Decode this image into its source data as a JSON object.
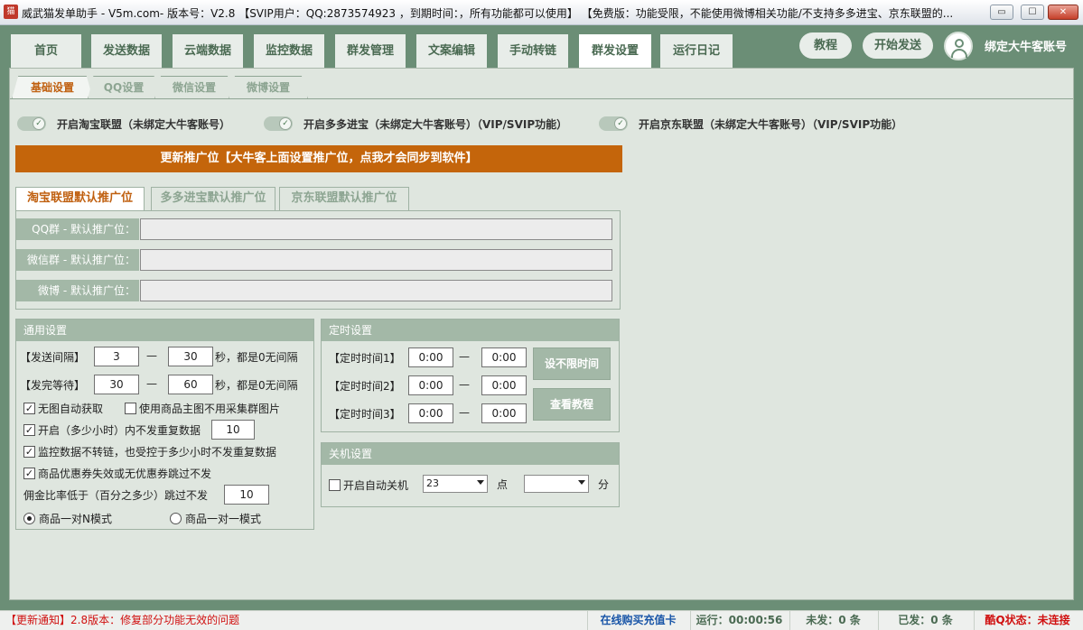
{
  "window": {
    "title": "威武猫发单助手 - V5m.com- 版本号：V2.8    【SVIP用户：QQ:2873574923 ，到期时间：，所有功能都可以使用】    【免费版：功能受限，不能使用微博相关功能/不支持多多进宝、京东联盟的...",
    "min": "▭",
    "max": "☐",
    "close": "✕"
  },
  "nav": {
    "tabs": [
      {
        "label": "首页"
      },
      {
        "label": "发送数据"
      },
      {
        "label": "云端数据"
      },
      {
        "label": "监控数据"
      },
      {
        "label": "群发管理"
      },
      {
        "label": "文案编辑"
      },
      {
        "label": "手动转链"
      },
      {
        "label": "群发设置"
      },
      {
        "label": "运行日记"
      }
    ],
    "active_index": 7,
    "tutorial": "教程",
    "start_send": "开始发送",
    "bind_account": "绑定大牛客账号"
  },
  "subtabs": [
    {
      "label": "基础设置"
    },
    {
      "label": "QQ设置"
    },
    {
      "label": "微信设置"
    },
    {
      "label": "微博设置"
    }
  ],
  "toggles": [
    {
      "label": "开启淘宝联盟（未绑定大牛客账号）",
      "on": true
    },
    {
      "label": "开启多多进宝（未绑定大牛客账号）（VIP/SVIP功能）",
      "on": true
    },
    {
      "label": "开启京东联盟（未绑定大牛客账号）（VIP/SVIP功能）",
      "on": true
    }
  ],
  "update_bar": "更新推广位【大牛客上面设置推广位，点我才会同步到软件】",
  "position_tabs": [
    {
      "label": "淘宝联盟默认推广位"
    },
    {
      "label": "多多进宝默认推广位"
    },
    {
      "label": "京东联盟默认推广位"
    }
  ],
  "position_rows": [
    {
      "label": "QQ群 - 默认推广位：",
      "value": ""
    },
    {
      "label": "微信群 - 默认推广位：",
      "value": ""
    },
    {
      "label": "微博 - 默认推广位：",
      "value": ""
    }
  ],
  "general": {
    "title": "通用设置",
    "send_interval_label": "【发送间隔】",
    "send_interval_min": "3",
    "send_interval_max": "30",
    "send_done_label": "【发完等待】",
    "send_done_min": "30",
    "send_done_max": "60",
    "dash": "—",
    "unit_note": "秒，都是0无间隔",
    "no_image_auto": "无图自动获取",
    "use_main_image": "使用商品主图不用采集群图片",
    "no_repeat_label": "开启（多少小时）内不发重复数据",
    "no_repeat_hours": "10",
    "monitor_no_convert": "监控数据不转链，也受控于多少小时不发重复数据",
    "skip_invalid_coupon": "商品优惠券失效或无优惠券跳过不发",
    "commission_label": "佣金比率低于（百分之多少）跳过不发",
    "commission_value": "10",
    "mode_1n": "商品一对N模式",
    "mode_11": "商品一对一模式"
  },
  "timer": {
    "title": "定时设置",
    "rows": [
      {
        "label": "【定时时间1】",
        "start": "0:00",
        "end": "0:00"
      },
      {
        "label": "【定时时间2】",
        "start": "0:00",
        "end": "0:00"
      },
      {
        "label": "【定时时间3】",
        "start": "0:00",
        "end": "0:00"
      }
    ],
    "dash": "—",
    "no_limit_button": "设不限时间",
    "tutorial_button": "查看教程"
  },
  "shutdown": {
    "title": "关机设置",
    "auto_shutdown": "开启自动关机",
    "hour_value": "23",
    "hour_unit": "点",
    "minute_value": "",
    "minute_unit": "分"
  },
  "status": {
    "notice": "【更新通知】2.8版本：修复部分功能无效的问题",
    "buy_card": "在线购买充值卡",
    "runtime": "运行：00:00:56",
    "unsent": "未发：0 条",
    "sent": "已发：0 条",
    "coolq": "酷Q状态：未连接"
  },
  "colors": {
    "nav_bg": "#6b8e76",
    "accent_orange": "#c4650b",
    "panel_bg": "#dfe6df",
    "status_red": "#d01010",
    "status_blue": "#1a56a8"
  }
}
